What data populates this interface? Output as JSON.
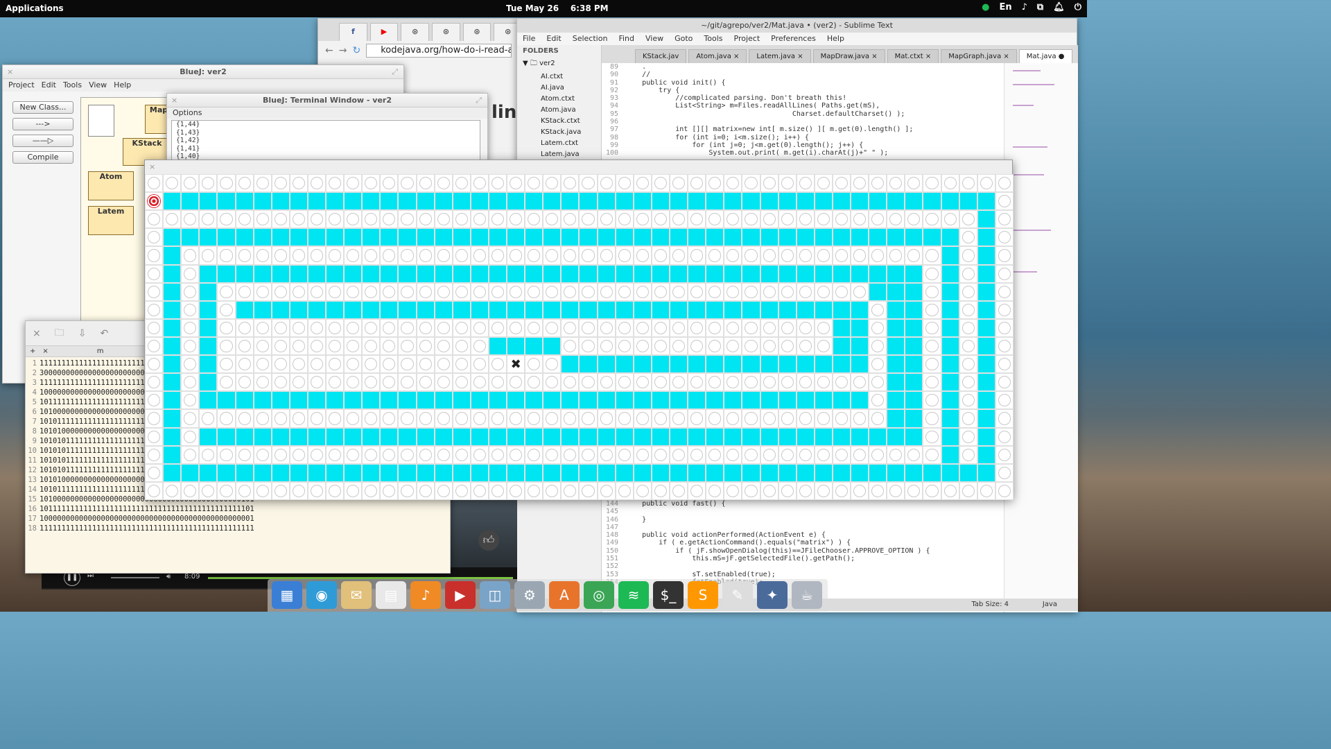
{
  "topbar": {
    "app_menu": "Applications",
    "date": "Tue May 26",
    "time": "6:38 PM",
    "lang": "En"
  },
  "chrome": {
    "tabs": [
      "f",
      "▶",
      "⊛",
      "⊛",
      "⊛",
      "⊛"
    ],
    "url": "kodejava.org/how-do-i-read-all-",
    "page_text": "line"
  },
  "sublime": {
    "title": "~/git/agrepo/ver2/Mat.java • (ver2) - Sublime Text",
    "menu": [
      "File",
      "Edit",
      "Selection",
      "Find",
      "View",
      "Goto",
      "Tools",
      "Project",
      "Preferences",
      "Help"
    ],
    "folders_header": "FOLDERS",
    "root_folder": "ver2",
    "files": [
      "AI.ctxt",
      "AI.java",
      "Atom.ctxt",
      "Atom.java",
      "KStack.ctxt",
      "KStack.java",
      "Latem.ctxt",
      "Latem.java"
    ],
    "tabs": [
      "KStack.jav",
      "Atom.java",
      "Latem.java",
      "MapDraw.java",
      "Mat.ctxt",
      "MapGraph.java",
      "Mat.java"
    ],
    "code_top": [
      {
        "n": "89",
        "t": "    ."
      },
      {
        "n": "90",
        "t": "    //"
      },
      {
        "n": "91",
        "t": "    public void init() {"
      },
      {
        "n": "92",
        "t": "        try {"
      },
      {
        "n": "93",
        "t": "            //complicated parsing. Don't breath this!"
      },
      {
        "n": "94",
        "t": "            List<String> m=Files.readAllLines( Paths.get(mS),"
      },
      {
        "n": "95",
        "t": "                                        Charset.defaultCharset() );"
      },
      {
        "n": "96",
        "t": ""
      },
      {
        "n": "97",
        "t": "            int [][] matrix=new int[ m.size() ][ m.get(0).length() ];"
      },
      {
        "n": "98",
        "t": "            for (int i=0; i<m.size(); i++) {"
      },
      {
        "n": "99",
        "t": "                for (int j=0; j<m.get(0).length(); j++) {"
      },
      {
        "n": "100",
        "t": "                    System.out.print( m.get(i).charAt(j)+\" \" );"
      }
    ],
    "code_bottom": [
      {
        "n": "144",
        "t": "    public void fast() {"
      },
      {
        "n": "145",
        "t": ""
      },
      {
        "n": "146",
        "t": "    }"
      },
      {
        "n": "147",
        "t": ""
      },
      {
        "n": "148",
        "t": "    public void actionPerformed(ActionEvent e) {"
      },
      {
        "n": "149",
        "t": "        if ( e.getActionCommand().equals(\"matrix\") ) {"
      },
      {
        "n": "150",
        "t": "            if ( jF.showOpenDialog(this)==JFileChooser.APPROVE_OPTION ) {"
      },
      {
        "n": "151",
        "t": "                this.mS=jF.getSelectedFile().getPath();"
      },
      {
        "n": "152",
        "t": ""
      },
      {
        "n": "153",
        "t": "                sT.setEnabled(true);"
      },
      {
        "n": "154",
        "t": "                fetEnabled(true);"
      }
    ],
    "status_tab": "Tab Size: 4",
    "status_lang": "Java"
  },
  "bluej": {
    "title": "BlueJ:  ver2",
    "menu": [
      "Project",
      "Edit",
      "Tools",
      "View",
      "Help"
    ],
    "buttons": [
      "New Class...",
      "--->",
      "——▷",
      "Compile"
    ],
    "classes": [
      "Map",
      "KStack",
      "Atom",
      "Latem"
    ]
  },
  "terminal": {
    "title": "BlueJ: Terminal Window - ver2",
    "options": "Options",
    "lines": [
      "{1,44}",
      "{1,43}",
      "{1,42}",
      "{1,41}",
      "{1,40}"
    ]
  },
  "gedit": {
    "tab": "m",
    "lines": [
      "1111111111111111111111111111111111111111111111111",
      "3000000000000000000000000000000000000000000000001",
      "1111111111111111111111111111111111111111111111101",
      "1000000000000000000000000000000000000000000000101",
      "1011111111111111111111111111111111111111111110101",
      "1010000000000000000000000000000000000000000010101",
      "1010111111111111111111111111111111111111110010101",
      "1010100000000000000000000000000000000000010010101",
      "1010101111111111111111111111111111111111010010101",
      "1010101111111111111111111111111111111111010010101",
      "1010101111111111111111111111111111111111010010101",
      "1010101111111111111111111111111111111111010010101",
      "1010100000000000000000000000000000000000010010101",
      "1010111111111111111111111111111111111111110010101",
      "1010000000000000000000000000000000000000000000101",
      "1011111111111111111111111111111111111111111111101",
      "1000000000000000000000000000000000000000000000001",
      "1111111111111111111111111111111111111111111111111"
    ]
  },
  "video": {
    "time": "8:09"
  },
  "maze": {
    "rows": [
      "111111111111111111111111111111111111111111111111",
      "300000000000000000000000000000000000000000000001",
      "111111111111111111111111111111111111111111111101",
      "100000000000000000000000000000000000000000000101",
      "101111111111111111111111111111111111111111110101",
      "101000000000000000000000000000000000000000010101",
      "101011111111111111111111111111111111111100010101",
      "101010000000000000000000000000000000000010010101",
      "101011111111111111111111111111111111110010010101",
      "101011111111111111100001111111111111110010010101",
      "101011111111111111112110000000000000000010010101",
      "101011111111111111111111111111111111111110010101",
      "101000000000000000000000000000000000000010010101",
      "101111111111111111111111111111111111111110010101",
      "101000000000000000000000000000000000000000010101",
      "101111111111111111111111111111111111111111110101",
      "100000000000000000000000000000000000000000000001",
      "111111111111111111111111111111111111111111111111"
    ]
  },
  "dock": {
    "items": [
      {
        "name": "workspaces-icon",
        "glyph": "▦",
        "color": "#3a7fd5"
      },
      {
        "name": "browser-icon",
        "glyph": "◉",
        "color": "#2f9bd6"
      },
      {
        "name": "mail-icon",
        "glyph": "✉",
        "color": "#e0c07a"
      },
      {
        "name": "calendar-icon",
        "glyph": "▤",
        "color": "#e8e8e8"
      },
      {
        "name": "music-icon",
        "glyph": "♪",
        "color": "#f08a24"
      },
      {
        "name": "video-icon",
        "glyph": "▶",
        "color": "#c9302c"
      },
      {
        "name": "photos-icon",
        "glyph": "◫",
        "color": "#7aa3c8"
      },
      {
        "name": "settings-icon",
        "glyph": "⚙",
        "color": "#9aa7b3"
      },
      {
        "name": "appcenter-icon",
        "glyph": "A",
        "color": "#e8742c"
      },
      {
        "name": "chrome-icon",
        "glyph": "◎",
        "color": "#3aa655"
      },
      {
        "name": "spotify-icon",
        "glyph": "≋",
        "color": "#1db954"
      },
      {
        "name": "terminal-icon",
        "glyph": "$_",
        "color": "#333333"
      },
      {
        "name": "sublime-icon",
        "glyph": "S",
        "color": "#ff9800"
      },
      {
        "name": "text-editor-icon",
        "glyph": "✎",
        "color": "#dddddd"
      },
      {
        "name": "bluej-icon",
        "glyph": "✦",
        "color": "#4a6a9a"
      },
      {
        "name": "java-icon",
        "glyph": "☕",
        "color": "#b0b7c0"
      }
    ]
  }
}
